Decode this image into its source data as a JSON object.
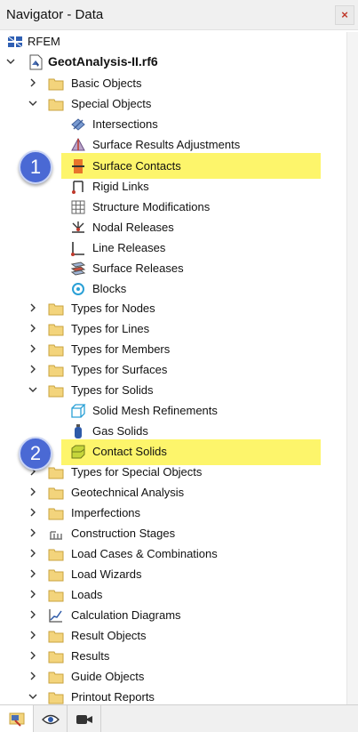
{
  "window": {
    "title": "Navigator - Data",
    "close_symbol": "×"
  },
  "tree": {
    "root": "RFEM",
    "file": "GeotAnalysis-II.rf6",
    "basic_objects": "Basic Objects",
    "special_objects": "Special Objects",
    "special_children": [
      "Intersections",
      "Surface Results Adjustments",
      "Surface Contacts",
      "Rigid Links",
      "Structure Modifications",
      "Nodal Releases",
      "Line Releases",
      "Surface Releases",
      "Blocks"
    ],
    "types_for_nodes": "Types for Nodes",
    "types_for_lines": "Types for Lines",
    "types_for_members": "Types for Members",
    "types_for_surfaces": "Types for Surfaces",
    "types_for_solids": "Types for Solids",
    "solids_children": [
      "Solid Mesh Refinements",
      "Gas Solids",
      "Contact Solids"
    ],
    "after": [
      "Types for Special Objects",
      "Geotechnical Analysis",
      "Imperfections",
      "Construction Stages",
      "Load Cases & Combinations",
      "Load Wizards",
      "Loads",
      "Calculation Diagrams",
      "Result Objects",
      "Results",
      "Guide Objects",
      "Printout Reports"
    ]
  },
  "badges": [
    "1",
    "2"
  ],
  "colors": {
    "highlight": "#fdf56b",
    "badge": "#4a69d4",
    "folder": "#f3d47c"
  }
}
